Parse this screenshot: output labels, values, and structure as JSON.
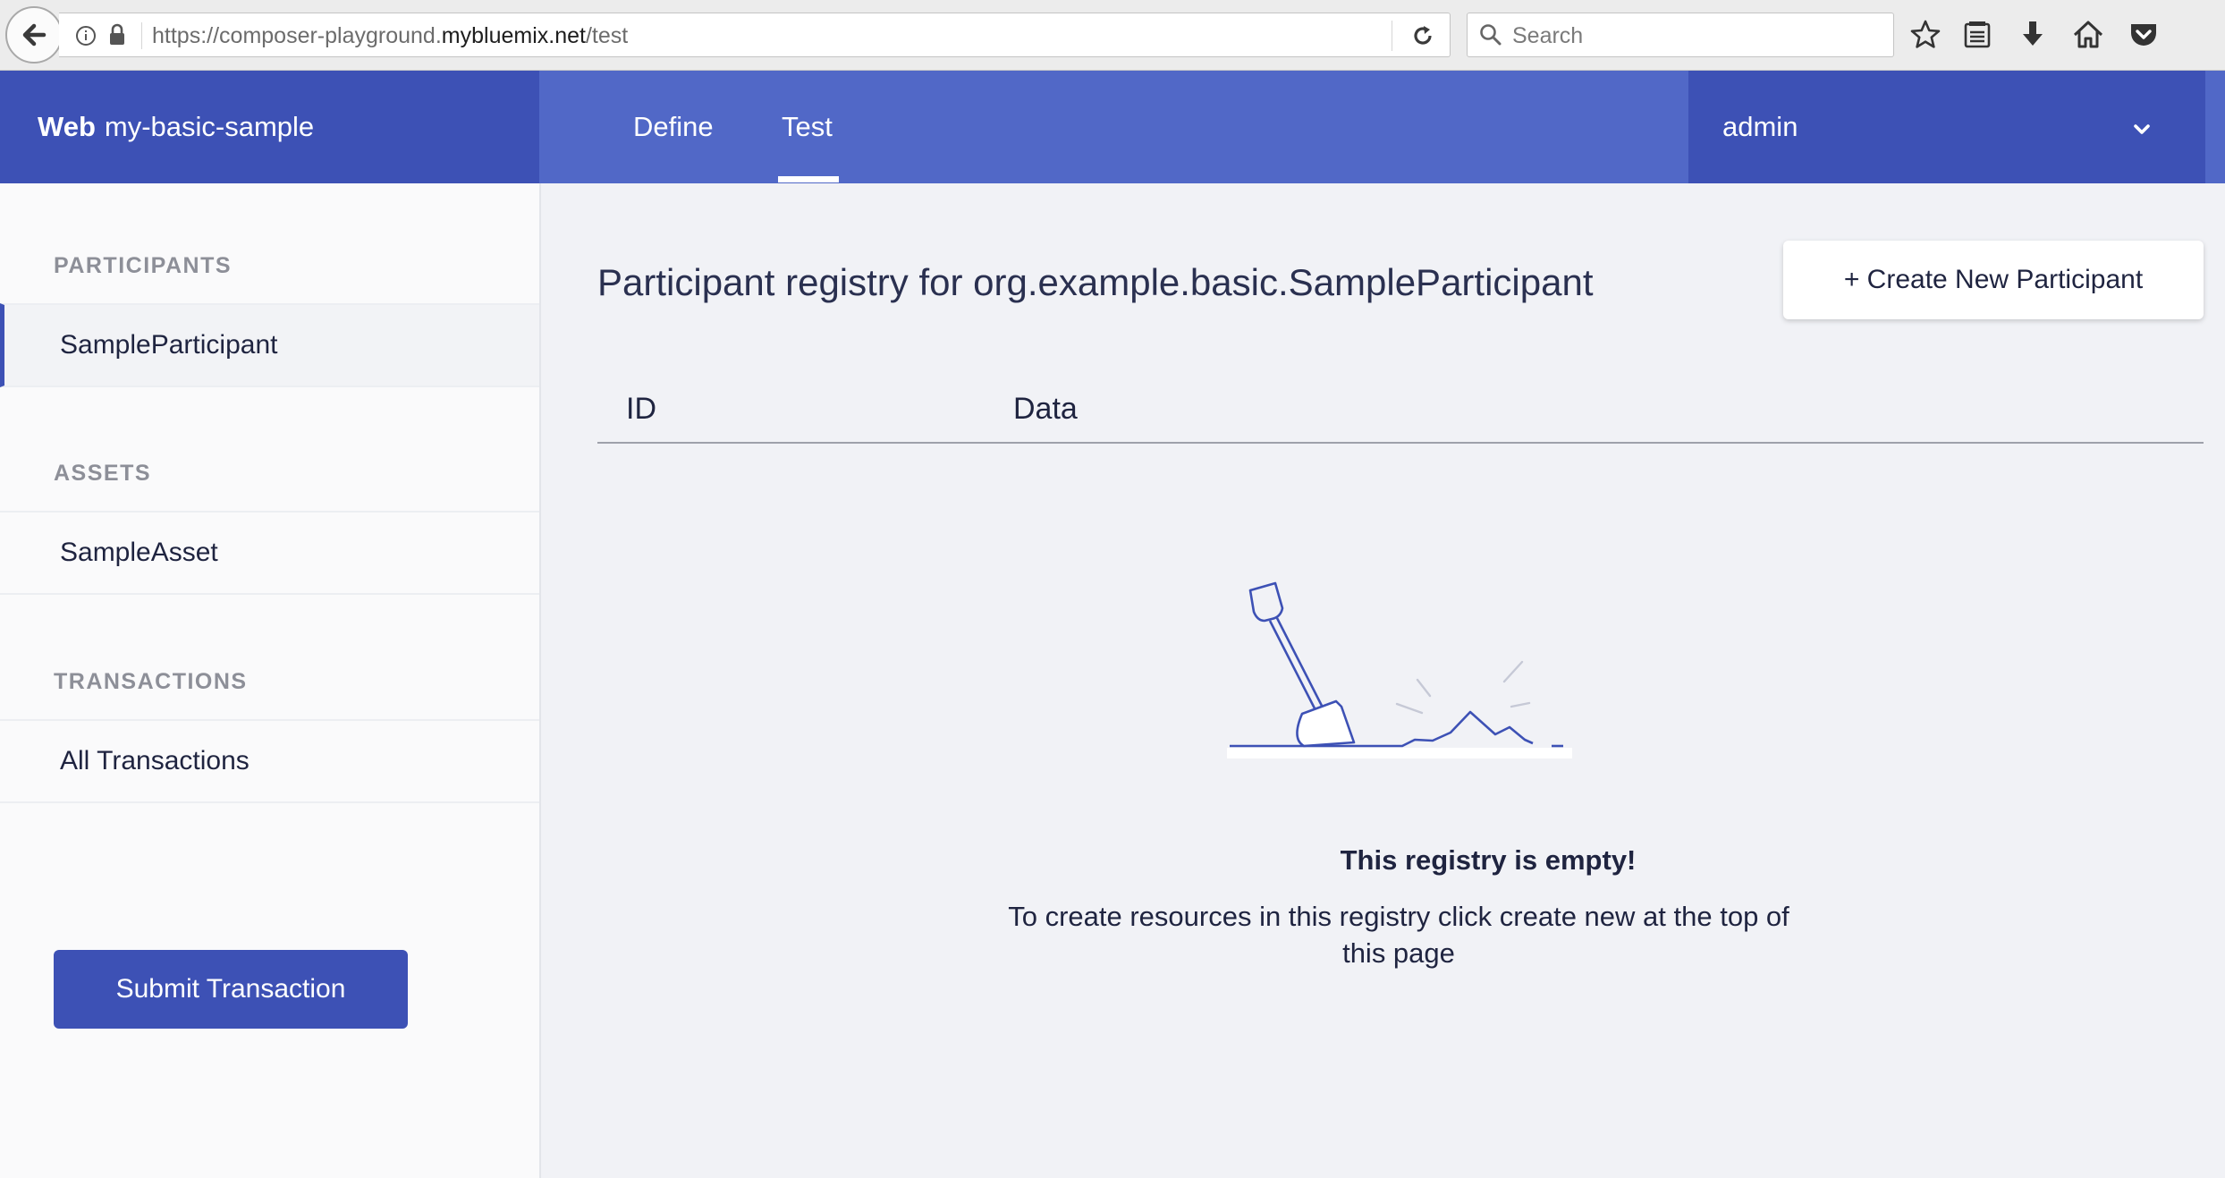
{
  "browser": {
    "url_prefix": "https://composer-playground.",
    "url_domain": "mybluemix.net",
    "url_path": "/test",
    "search_placeholder": "Search"
  },
  "header": {
    "brand_bold": "Web",
    "brand_name": "my-basic-sample",
    "tabs": [
      {
        "label": "Define"
      },
      {
        "label": "Test",
        "active": true
      }
    ],
    "user": "admin"
  },
  "sidebar": {
    "sections": [
      {
        "heading": "PARTICIPANTS",
        "items": [
          {
            "label": "SampleParticipant",
            "active": true
          }
        ]
      },
      {
        "heading": "ASSETS",
        "items": [
          {
            "label": "SampleAsset"
          }
        ]
      },
      {
        "heading": "TRANSACTIONS",
        "items": [
          {
            "label": "All Transactions"
          }
        ]
      }
    ],
    "submit_label": "Submit Transaction"
  },
  "main": {
    "title": "Participant registry for org.example.basic.SampleParticipant",
    "create_label": "+ Create New Participant",
    "columns": [
      "ID",
      "Data"
    ],
    "empty_title": "This registry is empty!",
    "empty_desc": "To create resources in this registry click create new at the top of this page"
  },
  "colors": {
    "primary_dark": "#3d51b5",
    "primary": "#5168c7",
    "background": "#f1f2f6"
  }
}
